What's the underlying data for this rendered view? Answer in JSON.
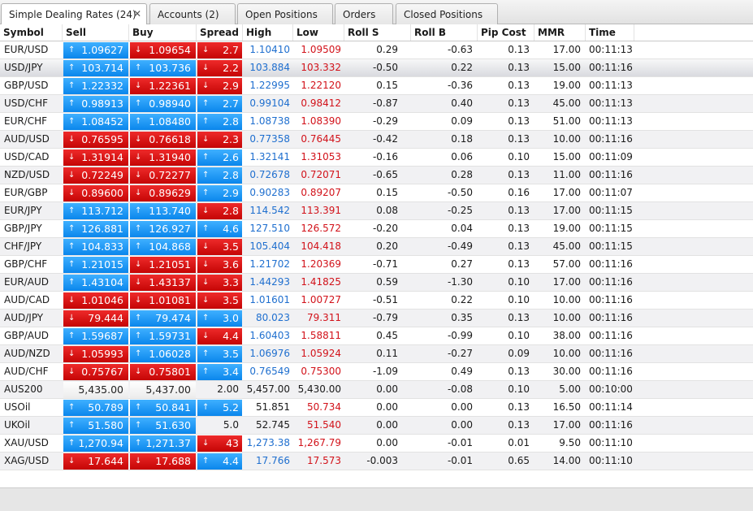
{
  "tabs": [
    {
      "label": "Simple Dealing Rates (24)",
      "active": true,
      "closable": true
    },
    {
      "label": "Accounts (2)"
    },
    {
      "label": "Open Positions"
    },
    {
      "label": "Orders"
    },
    {
      "label": "Closed Positions"
    }
  ],
  "tab_close_glyph": "✕",
  "columns": {
    "symbol": "Symbol",
    "sell": "Sell",
    "buy": "Buy",
    "spread": "Spread",
    "high": "High",
    "low": "Low",
    "roll_s": "Roll S",
    "roll_b": "Roll B",
    "pip_cost": "Pip Cost",
    "mmr": "MMR",
    "time": "Time"
  },
  "colors": {
    "up": "#0a86ec",
    "down": "#c50505",
    "high_text": "#1f6fcf",
    "low_text": "#d2121a"
  },
  "icons": {
    "up": "arrow-up-icon",
    "down": "arrow-down-icon"
  },
  "rows": [
    {
      "symbol": "EUR/USD",
      "sell": "1.09627",
      "sell_dir": "up",
      "buy": "1.09654",
      "buy_dir": "down",
      "spread": "2.7",
      "spread_dir": "down",
      "high": "1.10410",
      "low": "1.09509",
      "roll_s": "0.29",
      "roll_b": "-0.63",
      "pip_cost": "0.13",
      "mmr": "17.00",
      "time": "00:11:13"
    },
    {
      "symbol": "USD/JPY",
      "sell": "103.714",
      "sell_dir": "up",
      "buy": "103.736",
      "buy_dir": "up",
      "spread": "2.2",
      "spread_dir": "down",
      "high": "103.884",
      "low": "103.332",
      "roll_s": "-0.50",
      "roll_b": "0.22",
      "pip_cost": "0.13",
      "mmr": "15.00",
      "time": "00:11:16",
      "selected": true
    },
    {
      "symbol": "GBP/USD",
      "sell": "1.22332",
      "sell_dir": "up",
      "buy": "1.22361",
      "buy_dir": "down",
      "spread": "2.9",
      "spread_dir": "down",
      "high": "1.22995",
      "low": "1.22120",
      "roll_s": "0.15",
      "roll_b": "-0.36",
      "pip_cost": "0.13",
      "mmr": "19.00",
      "time": "00:11:13"
    },
    {
      "symbol": "USD/CHF",
      "sell": "0.98913",
      "sell_dir": "up",
      "buy": "0.98940",
      "buy_dir": "up",
      "spread": "2.7",
      "spread_dir": "up",
      "high": "0.99104",
      "low": "0.98412",
      "roll_s": "-0.87",
      "roll_b": "0.40",
      "pip_cost": "0.13",
      "mmr": "45.00",
      "time": "00:11:13"
    },
    {
      "symbol": "EUR/CHF",
      "sell": "1.08452",
      "sell_dir": "up",
      "buy": "1.08480",
      "buy_dir": "up",
      "spread": "2.8",
      "spread_dir": "up",
      "high": "1.08738",
      "low": "1.08390",
      "roll_s": "-0.29",
      "roll_b": "0.09",
      "pip_cost": "0.13",
      "mmr": "51.00",
      "time": "00:11:13"
    },
    {
      "symbol": "AUD/USD",
      "sell": "0.76595",
      "sell_dir": "down",
      "buy": "0.76618",
      "buy_dir": "down",
      "spread": "2.3",
      "spread_dir": "down",
      "high": "0.77358",
      "low": "0.76445",
      "roll_s": "-0.42",
      "roll_b": "0.18",
      "pip_cost": "0.13",
      "mmr": "10.00",
      "time": "00:11:16"
    },
    {
      "symbol": "USD/CAD",
      "sell": "1.31914",
      "sell_dir": "down",
      "buy": "1.31940",
      "buy_dir": "down",
      "spread": "2.6",
      "spread_dir": "up",
      "high": "1.32141",
      "low": "1.31053",
      "roll_s": "-0.16",
      "roll_b": "0.06",
      "pip_cost": "0.10",
      "mmr": "15.00",
      "time": "00:11:09"
    },
    {
      "symbol": "NZD/USD",
      "sell": "0.72249",
      "sell_dir": "down",
      "buy": "0.72277",
      "buy_dir": "down",
      "spread": "2.8",
      "spread_dir": "up",
      "high": "0.72678",
      "low": "0.72071",
      "roll_s": "-0.65",
      "roll_b": "0.28",
      "pip_cost": "0.13",
      "mmr": "11.00",
      "time": "00:11:16"
    },
    {
      "symbol": "EUR/GBP",
      "sell": "0.89600",
      "sell_dir": "down",
      "buy": "0.89629",
      "buy_dir": "down",
      "spread": "2.9",
      "spread_dir": "up",
      "high": "0.90283",
      "low": "0.89207",
      "roll_s": "0.15",
      "roll_b": "-0.50",
      "pip_cost": "0.16",
      "mmr": "17.00",
      "time": "00:11:07"
    },
    {
      "symbol": "EUR/JPY",
      "sell": "113.712",
      "sell_dir": "up",
      "buy": "113.740",
      "buy_dir": "up",
      "spread": "2.8",
      "spread_dir": "down",
      "high": "114.542",
      "low": "113.391",
      "roll_s": "0.08",
      "roll_b": "-0.25",
      "pip_cost": "0.13",
      "mmr": "17.00",
      "time": "00:11:15"
    },
    {
      "symbol": "GBP/JPY",
      "sell": "126.881",
      "sell_dir": "up",
      "buy": "126.927",
      "buy_dir": "up",
      "spread": "4.6",
      "spread_dir": "up",
      "high": "127.510",
      "low": "126.572",
      "roll_s": "-0.20",
      "roll_b": "0.04",
      "pip_cost": "0.13",
      "mmr": "19.00",
      "time": "00:11:15"
    },
    {
      "symbol": "CHF/JPY",
      "sell": "104.833",
      "sell_dir": "up",
      "buy": "104.868",
      "buy_dir": "up",
      "spread": "3.5",
      "spread_dir": "down",
      "high": "105.404",
      "low": "104.418",
      "roll_s": "0.20",
      "roll_b": "-0.49",
      "pip_cost": "0.13",
      "mmr": "45.00",
      "time": "00:11:15"
    },
    {
      "symbol": "GBP/CHF",
      "sell": "1.21015",
      "sell_dir": "up",
      "buy": "1.21051",
      "buy_dir": "down",
      "spread": "3.6",
      "spread_dir": "down",
      "high": "1.21702",
      "low": "1.20369",
      "roll_s": "-0.71",
      "roll_b": "0.27",
      "pip_cost": "0.13",
      "mmr": "57.00",
      "time": "00:11:16"
    },
    {
      "symbol": "EUR/AUD",
      "sell": "1.43104",
      "sell_dir": "up",
      "buy": "1.43137",
      "buy_dir": "down",
      "spread": "3.3",
      "spread_dir": "down",
      "high": "1.44293",
      "low": "1.41825",
      "roll_s": "0.59",
      "roll_b": "-1.30",
      "pip_cost": "0.10",
      "mmr": "17.00",
      "time": "00:11:16"
    },
    {
      "symbol": "AUD/CAD",
      "sell": "1.01046",
      "sell_dir": "down",
      "buy": "1.01081",
      "buy_dir": "down",
      "spread": "3.5",
      "spread_dir": "down",
      "high": "1.01601",
      "low": "1.00727",
      "roll_s": "-0.51",
      "roll_b": "0.22",
      "pip_cost": "0.10",
      "mmr": "10.00",
      "time": "00:11:16"
    },
    {
      "symbol": "AUD/JPY",
      "sell": "79.444",
      "sell_dir": "down",
      "buy": "79.474",
      "buy_dir": "up",
      "spread": "3.0",
      "spread_dir": "up",
      "high": "80.023",
      "low": "79.311",
      "roll_s": "-0.79",
      "roll_b": "0.35",
      "pip_cost": "0.13",
      "mmr": "10.00",
      "time": "00:11:16"
    },
    {
      "symbol": "GBP/AUD",
      "sell": "1.59687",
      "sell_dir": "up",
      "buy": "1.59731",
      "buy_dir": "up",
      "spread": "4.4",
      "spread_dir": "down",
      "high": "1.60403",
      "low": "1.58811",
      "roll_s": "0.45",
      "roll_b": "-0.99",
      "pip_cost": "0.10",
      "mmr": "38.00",
      "time": "00:11:16"
    },
    {
      "symbol": "AUD/NZD",
      "sell": "1.05993",
      "sell_dir": "down",
      "buy": "1.06028",
      "buy_dir": "up",
      "spread": "3.5",
      "spread_dir": "up",
      "high": "1.06976",
      "low": "1.05924",
      "roll_s": "0.11",
      "roll_b": "-0.27",
      "pip_cost": "0.09",
      "mmr": "10.00",
      "time": "00:11:16"
    },
    {
      "symbol": "AUD/CHF",
      "sell": "0.75767",
      "sell_dir": "down",
      "buy": "0.75801",
      "buy_dir": "down",
      "spread": "3.4",
      "spread_dir": "up",
      "high": "0.76549",
      "low": "0.75300",
      "roll_s": "-1.09",
      "roll_b": "0.49",
      "pip_cost": "0.13",
      "mmr": "30.00",
      "time": "00:11:16"
    },
    {
      "symbol": "AUS200",
      "sell": "5,435.00",
      "sell_dir": "none",
      "buy": "5,437.00",
      "buy_dir": "none",
      "spread": "2.00",
      "spread_dir": "none",
      "high": "5,457.00",
      "low": "5,430.00",
      "high_color": "none",
      "low_color": "none",
      "roll_s": "0.00",
      "roll_b": "-0.08",
      "pip_cost": "0.10",
      "mmr": "5.00",
      "time": "00:10:00"
    },
    {
      "symbol": "USOil",
      "sell": "50.789",
      "sell_dir": "up",
      "buy": "50.841",
      "buy_dir": "up",
      "spread": "5.2",
      "spread_dir": "up",
      "high": "51.851",
      "low": "50.734",
      "high_color": "none",
      "roll_s": "0.00",
      "roll_b": "0.00",
      "pip_cost": "0.13",
      "mmr": "16.50",
      "time": "00:11:14"
    },
    {
      "symbol": "UKOil",
      "sell": "51.580",
      "sell_dir": "up",
      "buy": "51.630",
      "buy_dir": "up",
      "spread": "5.0",
      "spread_dir": "none",
      "high": "52.745",
      "low": "51.540",
      "high_color": "none",
      "roll_s": "0.00",
      "roll_b": "0.00",
      "pip_cost": "0.13",
      "mmr": "17.00",
      "time": "00:11:16"
    },
    {
      "symbol": "XAU/USD",
      "sell": "1,270.94",
      "sell_dir": "up",
      "buy": "1,271.37",
      "buy_dir": "up",
      "spread": "43",
      "spread_dir": "down",
      "high": "1,273.38",
      "low": "1,267.79",
      "roll_s": "0.00",
      "roll_b": "-0.01",
      "pip_cost": "0.01",
      "mmr": "9.50",
      "time": "00:11:10"
    },
    {
      "symbol": "XAG/USD",
      "sell": "17.644",
      "sell_dir": "down",
      "buy": "17.688",
      "buy_dir": "down",
      "spread": "4.4",
      "spread_dir": "up",
      "high": "17.766",
      "low": "17.573",
      "roll_s": "-0.003",
      "roll_b": "-0.01",
      "pip_cost": "0.65",
      "mmr": "14.00",
      "time": "00:11:10"
    }
  ]
}
